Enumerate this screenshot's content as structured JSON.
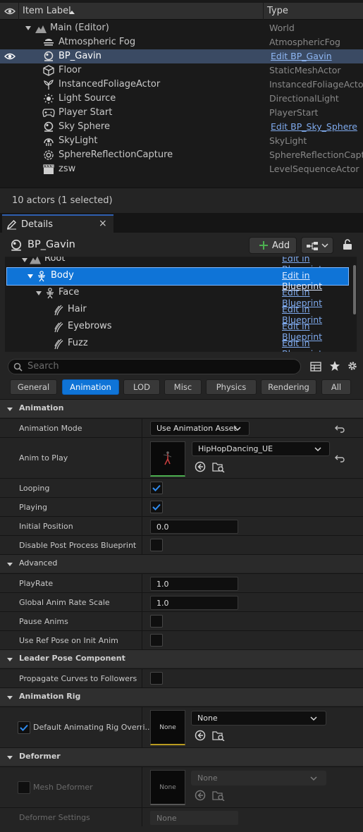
{
  "outliner": {
    "columns": {
      "label": "Item Label",
      "type": "Type"
    },
    "rows": [
      {
        "name": "Main (Editor)",
        "type": "World",
        "icon": "world-icon",
        "link": false
      },
      {
        "name": "Atmospheric Fog",
        "type": "AtmosphericFog",
        "icon": "fog-icon",
        "link": false
      },
      {
        "name": "BP_Gavin",
        "type": "Edit BP_Gavin",
        "icon": "blueprint-actor-icon",
        "link": true
      },
      {
        "name": "Floor",
        "type": "StaticMeshActor",
        "icon": "static-mesh-icon",
        "link": false
      },
      {
        "name": "InstancedFoliageActor",
        "type": "InstancedFoliageActor",
        "icon": "foliage-icon",
        "link": false
      },
      {
        "name": "Light Source",
        "type": "DirectionalLight",
        "icon": "sun-icon",
        "link": false
      },
      {
        "name": "Player Start",
        "type": "PlayerStart",
        "icon": "gamepad-icon",
        "link": false
      },
      {
        "name": "Sky Sphere",
        "type": "Edit BP_Sky_Sphere",
        "icon": "sphere-icon",
        "link": true
      },
      {
        "name": "SkyLight",
        "type": "SkyLight",
        "icon": "skylight-icon",
        "link": false
      },
      {
        "name": "SphereReflectionCapture",
        "type": "SphereReflectionCaptu",
        "icon": "reflection-icon",
        "link": false
      },
      {
        "name": "zsw",
        "type": "LevelSequenceActor",
        "icon": "clapper-icon",
        "link": false
      }
    ],
    "footer": "10 actors (1 selected)"
  },
  "details": {
    "tab_label": "Details",
    "tab_close": "×",
    "actor_name": "BP_Gavin",
    "add_label": "Add",
    "components": [
      {
        "name": "Root",
        "edit": "Edit in Blueprint"
      },
      {
        "name": "Body",
        "edit": "Edit in Blueprint"
      },
      {
        "name": "Face",
        "edit": "Edit in Blueprint"
      },
      {
        "name": "Hair",
        "edit": "Edit in Blueprint"
      },
      {
        "name": "Eyebrows",
        "edit": "Edit in Blueprint"
      },
      {
        "name": "Fuzz",
        "edit": "Edit in Blueprint"
      }
    ],
    "search_placeholder": "Search",
    "filters": [
      "General",
      "Animation",
      "LOD",
      "Misc",
      "Physics",
      "Rendering",
      "All"
    ],
    "active_filter": "Animation",
    "sections": {
      "animation": "Animation",
      "advanced": "Advanced",
      "leader": "Leader Pose Component",
      "rig": "Animation Rig",
      "deformer": "Deformer"
    },
    "props": {
      "animation_mode": {
        "label": "Animation Mode",
        "value": "Use Animation Asset"
      },
      "anim_to_play": {
        "label": "Anim to Play",
        "value": "HipHopDancing_UE"
      },
      "looping": {
        "label": "Looping",
        "checked": true
      },
      "playing": {
        "label": "Playing",
        "checked": true
      },
      "initial_position": {
        "label": "Initial Position",
        "value": "0.0"
      },
      "disable_pp": {
        "label": "Disable Post Process Blueprint",
        "checked": false
      },
      "play_rate": {
        "label": "PlayRate",
        "value": "1.0"
      },
      "global_rate": {
        "label": "Global Anim Rate Scale",
        "value": "1.0"
      },
      "pause_anims": {
        "label": "Pause Anims",
        "checked": false
      },
      "ref_pose": {
        "label": "Use Ref Pose on Init Anim",
        "checked": false
      },
      "propagate": {
        "label": "Propagate Curves to Followers",
        "checked": false
      },
      "default_rig": {
        "label": "Default Animating Rig Overri...",
        "checked": true,
        "thumb": "None",
        "value": "None"
      },
      "mesh_deformer": {
        "label": "Mesh Deformer",
        "checked": false,
        "thumb": "None",
        "value": "None"
      },
      "deformer_settings": {
        "label": "Deformer Settings",
        "value": "None"
      }
    },
    "accent": "#0f74d7"
  }
}
